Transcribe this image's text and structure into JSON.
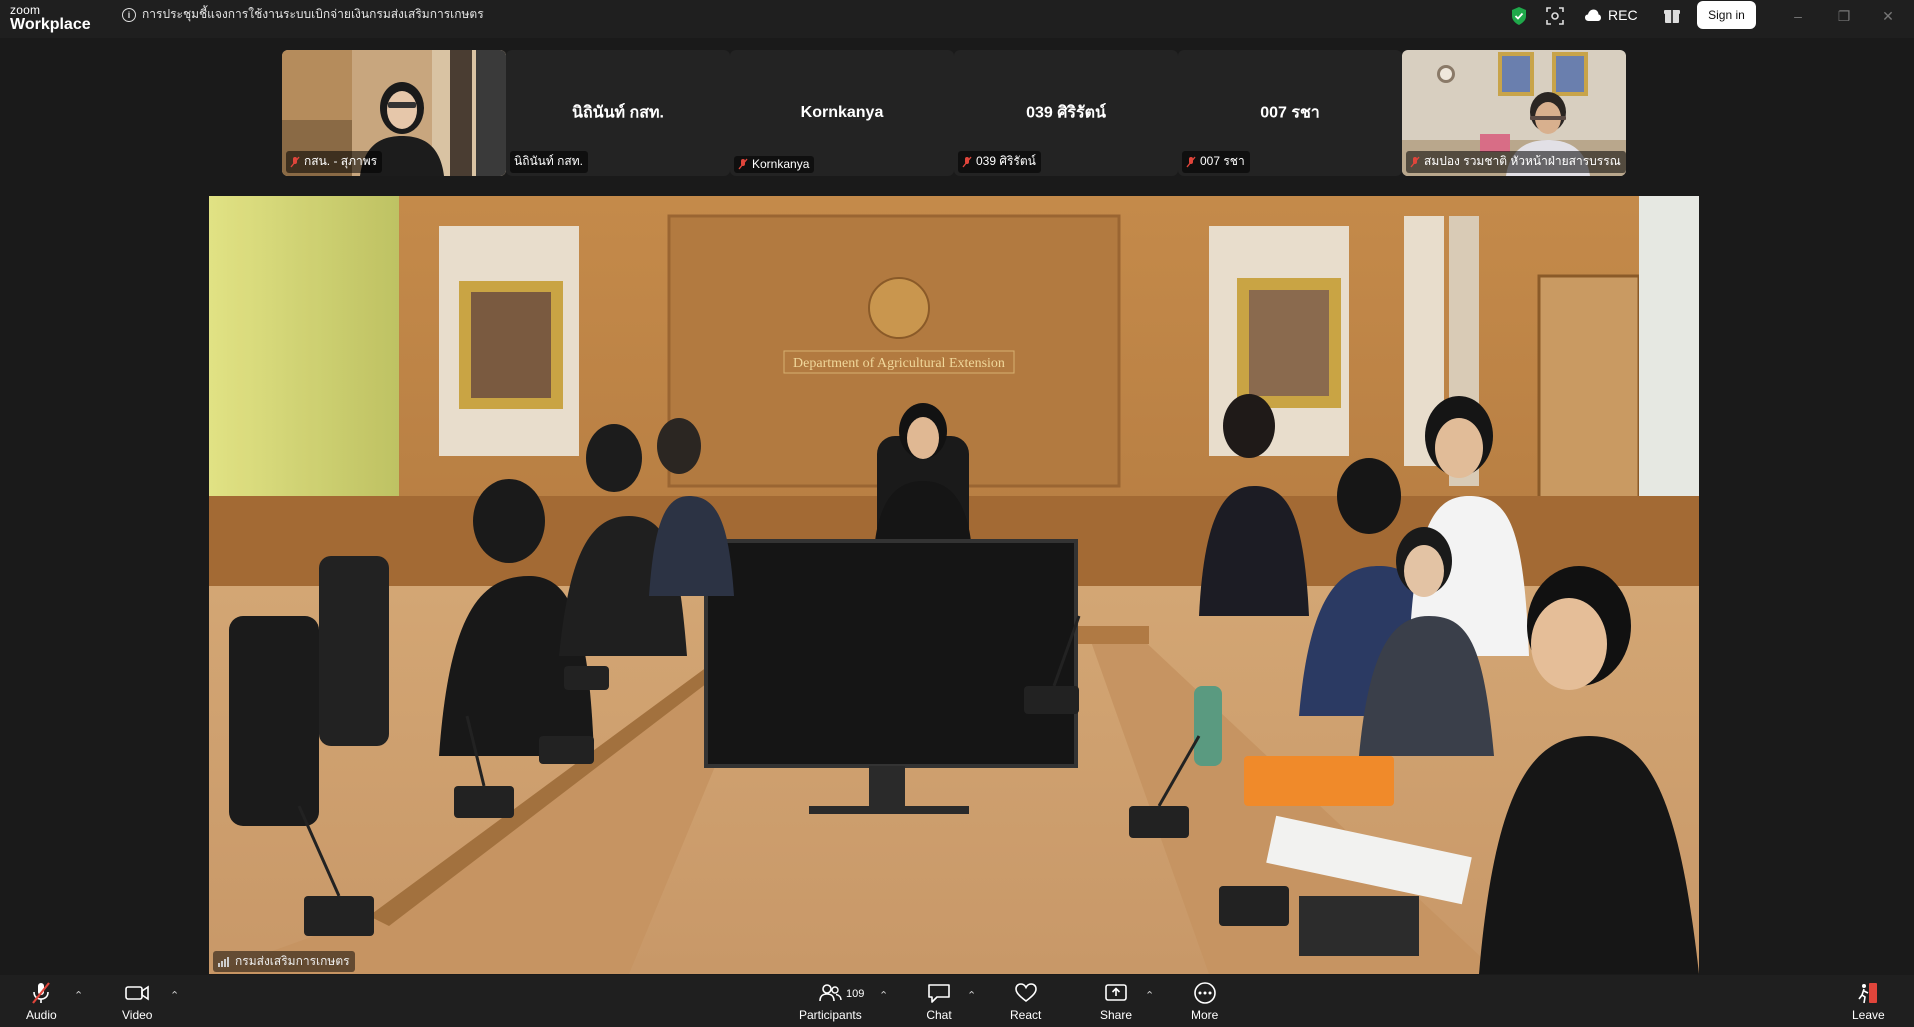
{
  "app": {
    "brand_small": "zoom",
    "brand_big": "Workplace",
    "meeting_title": "การประชุมชี้แจงการใช้งานระบบเบิกจ่ายเงินกรมส่งเสริมการเกษตร",
    "rec_label": "REC",
    "signin_label": "Sign in"
  },
  "gallery": [
    {
      "name_center": "",
      "label": "กสน. - สุภาพร",
      "has_video": true
    },
    {
      "name_center": "นิถินันท์ กสท.",
      "label": "นิถินันท์ กสท.",
      "has_video": false
    },
    {
      "name_center": "Kornkanya",
      "label": "Kornkanya",
      "has_video": false
    },
    {
      "name_center": "039 ศิริรัตน์",
      "label": "039 ศิริรัตน์",
      "has_video": false
    },
    {
      "name_center": "007 รชา",
      "label": "007 รชา",
      "has_video": false
    },
    {
      "name_center": "",
      "label": "สมปอง รวมชาติ หัวหน้าฝ่ายสารบรรณ",
      "has_video": true
    }
  ],
  "main_video": {
    "label": "กรมส่งเสริมการเกษตร",
    "plaque_text": "Department of Agricultural Extension"
  },
  "toolbar": {
    "audio": "Audio",
    "video": "Video",
    "participants": "Participants",
    "participants_count": "109",
    "chat": "Chat",
    "react": "React",
    "share": "Share",
    "more": "More",
    "leave": "Leave"
  },
  "colors": {
    "accent_green": "#1fa84a",
    "leave_red": "#e0453b",
    "mic_off_red": "#e0453b"
  }
}
